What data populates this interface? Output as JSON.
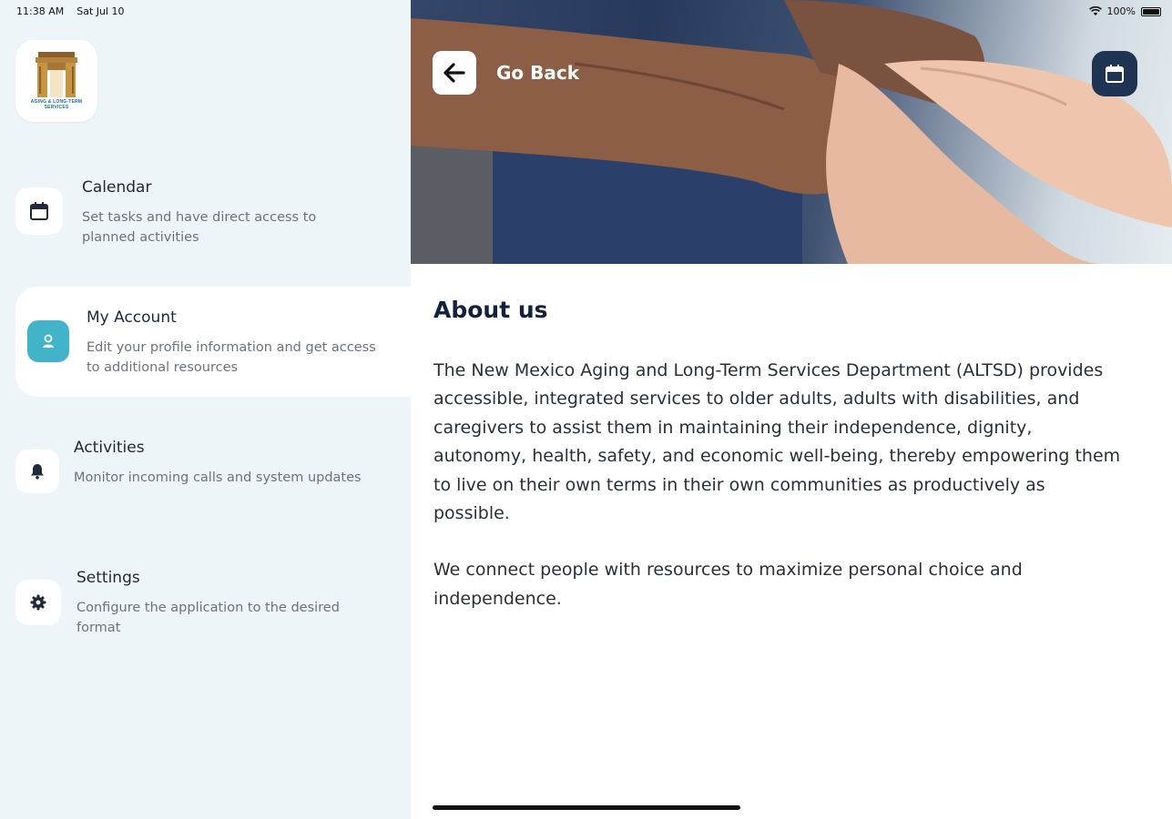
{
  "status_bar": {
    "time": "11:38 AM",
    "date": "Sat Jul 10",
    "battery": "100%"
  },
  "logo": {
    "text": "AGING & LONG-TERM SERVICES"
  },
  "sidebar": {
    "items": [
      {
        "title": "Calendar",
        "description": "Set tasks and have direct access to planned activities",
        "icon": "calendar-icon"
      },
      {
        "title": "My Account",
        "description": "Edit your profile information and get access to additional resources",
        "icon": "user-icon",
        "active": true
      },
      {
        "title": "Activities",
        "description": "Monitor incoming calls and system updates",
        "icon": "bell-icon"
      },
      {
        "title": "Settings",
        "description": "Configure the application to the desired format",
        "icon": "gear-icon"
      }
    ]
  },
  "header": {
    "back_label": "Go Back",
    "calendar_icon": "calendar-icon"
  },
  "about": {
    "title": "About us",
    "paragraph1": "The New Mexico Aging and Long-Term Services Department (ALTSD) provides accessible, integrated  services to older adults, adults with disabilities, and caregivers to assist them in maintaining their independence, dignity, autonomy, health, safety, and economic well-being, thereby empowering them to live on their own terms in their own communities as productively as possible.",
    "paragraph2": "We connect people with resources to maximize personal choice and independence."
  },
  "colors": {
    "sidebar_bg": "#eef5f8",
    "accent_teal": "#42b3c8",
    "dark_navy": "#1f3352",
    "title_color": "#14213d"
  }
}
